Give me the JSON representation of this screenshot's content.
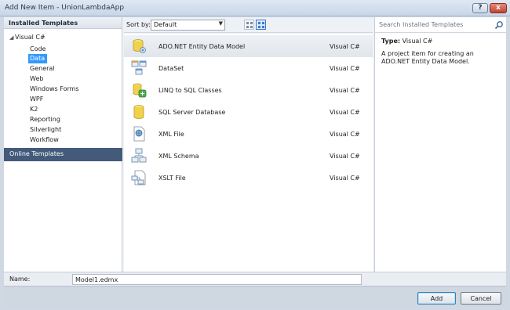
{
  "window": {
    "title": "Add New Item - UnionLambdaApp",
    "help_label": "?",
    "close_label": "x"
  },
  "left": {
    "header": "Installed Templates",
    "root": "Visual C#",
    "items": [
      "Code",
      "Data",
      "General",
      "Web",
      "Windows Forms",
      "WPF",
      "K2",
      "Reporting",
      "Silverlight",
      "Workflow"
    ],
    "selected": "Data",
    "online": "Online Templates"
  },
  "sortbar": {
    "label": "Sort by:",
    "value": "Default"
  },
  "templates": [
    {
      "name": "ADO.NET Entity Data Model",
      "lang": "Visual C#",
      "icon": "entity-model-icon",
      "selected": true
    },
    {
      "name": "DataSet",
      "lang": "Visual C#",
      "icon": "dataset-icon"
    },
    {
      "name": "LINQ to SQL Classes",
      "lang": "Visual C#",
      "icon": "linq-to-sql-icon"
    },
    {
      "name": "SQL Server Database",
      "lang": "Visual C#",
      "icon": "database-icon"
    },
    {
      "name": "XML File",
      "lang": "Visual C#",
      "icon": "xml-file-icon"
    },
    {
      "name": "XML Schema",
      "lang": "Visual C#",
      "icon": "xml-schema-icon"
    },
    {
      "name": "XSLT File",
      "lang": "Visual C#",
      "icon": "xslt-file-icon"
    }
  ],
  "right": {
    "search_placeholder": "Search Installed Templates",
    "type_label": "Type:",
    "type_value": "Visual C#",
    "description": "A project item for creating an ADO.NET Entity Data Model."
  },
  "name_field": {
    "label": "Name:",
    "value": "Model1.edmx"
  },
  "buttons": {
    "add": "Add",
    "cancel": "Cancel"
  }
}
